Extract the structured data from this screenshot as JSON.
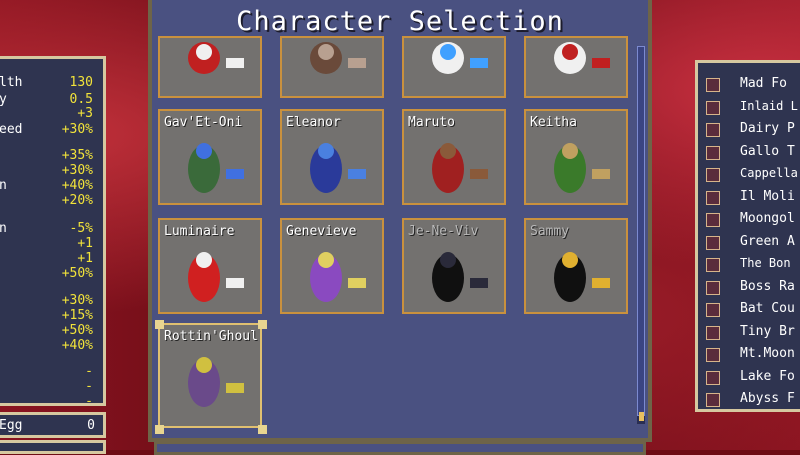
{
  "title": "Character Selection",
  "stats": [
    {
      "label": "lth",
      "value": "130"
    },
    {
      "label": "y",
      "value": "0.5"
    },
    {
      "label": "",
      "value": "+3"
    },
    {
      "label": "eed",
      "value": "+30%"
    },
    {
      "label": "",
      "value": "+35%"
    },
    {
      "label": "",
      "value": "+30%"
    },
    {
      "label": "n",
      "value": "+40%"
    },
    {
      "label": "",
      "value": "+20%"
    },
    {
      "label": "n",
      "value": "-5%"
    },
    {
      "label": "",
      "value": "+1"
    },
    {
      "label": "",
      "value": "+1"
    },
    {
      "label": "",
      "value": "+50%"
    },
    {
      "label": "",
      "value": "+30%"
    },
    {
      "label": "",
      "value": "+15%"
    },
    {
      "label": "",
      "value": "+50%"
    },
    {
      "label": "",
      "value": "+40%"
    },
    {
      "label": "",
      "value": "-"
    },
    {
      "label": "",
      "value": "-"
    },
    {
      "label": "",
      "value": "-"
    }
  ],
  "egg": {
    "label": "Egg",
    "value": "0"
  },
  "characters": [
    {
      "name": "",
      "locked": false
    },
    {
      "name": "",
      "locked": false
    },
    {
      "name": "",
      "locked": false
    },
    {
      "name": "",
      "locked": false
    },
    {
      "name": "Gav'Et-Oni",
      "locked": false
    },
    {
      "name": "Eleanor",
      "locked": false
    },
    {
      "name": "Maruto",
      "locked": false
    },
    {
      "name": "Keitha",
      "locked": false
    },
    {
      "name": "Luminaire",
      "locked": false
    },
    {
      "name": "Genevieve",
      "locked": false
    },
    {
      "name": "Je-Ne-Viv",
      "locked": true
    },
    {
      "name": "Sammy",
      "locked": true
    },
    {
      "name": "Rottin'Ghoul",
      "locked": false,
      "selected": true
    }
  ],
  "stages": [
    "Mad Fo",
    "Inlaid L",
    "Dairy P",
    "Gallo T",
    "Cappella",
    "Il Moli",
    "Moongol",
    "Green A",
    "The Bon",
    "Boss Ra",
    "Bat Cou",
    "Tiny Br",
    "Mt.Moon",
    "Lake Fo",
    "Abyss F"
  ],
  "colors": {
    "panel": "#4a5181",
    "card": "#73716f",
    "card_border": "#c9913e",
    "stat_value": "#f2e33a"
  }
}
